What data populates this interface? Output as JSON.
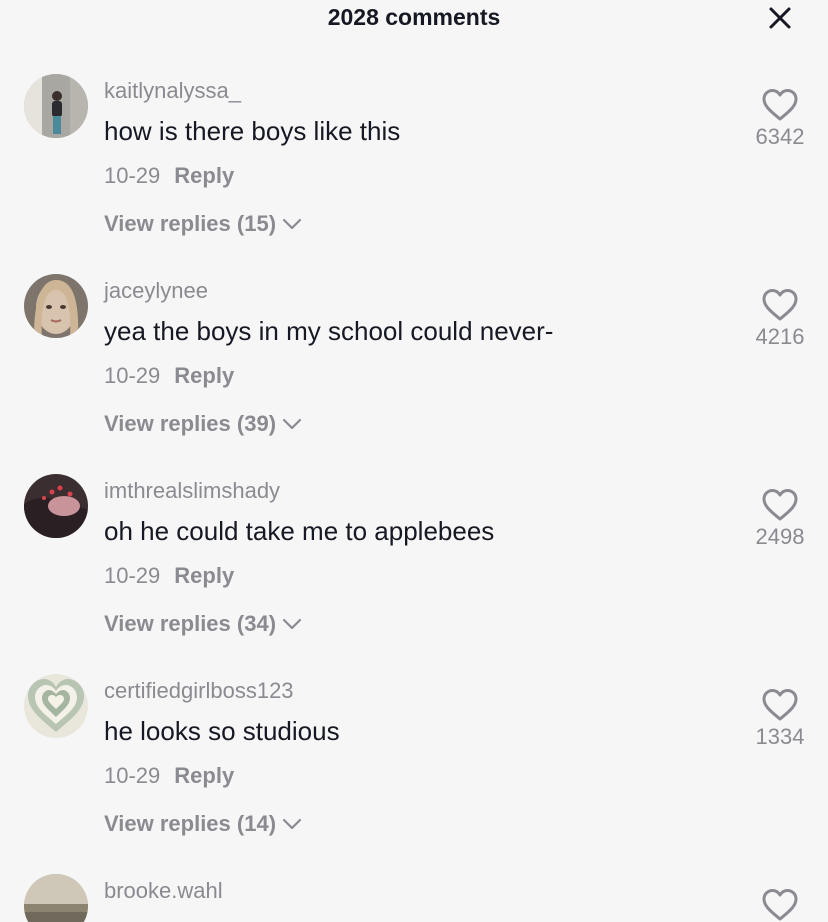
{
  "header": {
    "title": "2028 comments",
    "close_icon": "close-icon"
  },
  "comments": [
    {
      "username": "kaitlynalyssa_",
      "text": "how is there boys like this",
      "date": "10-29",
      "reply_label": "Reply",
      "view_replies": "View replies (15)",
      "likes": "6342"
    },
    {
      "username": "jaceylynee",
      "text": "yea the boys in my school could never-",
      "date": "10-29",
      "reply_label": "Reply",
      "view_replies": "View replies (39)",
      "likes": "4216"
    },
    {
      "username": "imthrealslimshady",
      "text": "oh he could take me to applebees",
      "date": "10-29",
      "reply_label": "Reply",
      "view_replies": "View replies (34)",
      "likes": "2498"
    },
    {
      "username": "certifiedgirlboss123",
      "text": "he looks so studious",
      "date": "10-29",
      "reply_label": "Reply",
      "view_replies": "View replies (14)",
      "likes": "1334"
    },
    {
      "username": "brooke.wahl"
    }
  ],
  "colors": {
    "background": "#f6f6f6",
    "primary_text": "#161823",
    "secondary_text": "#8a8b91"
  }
}
